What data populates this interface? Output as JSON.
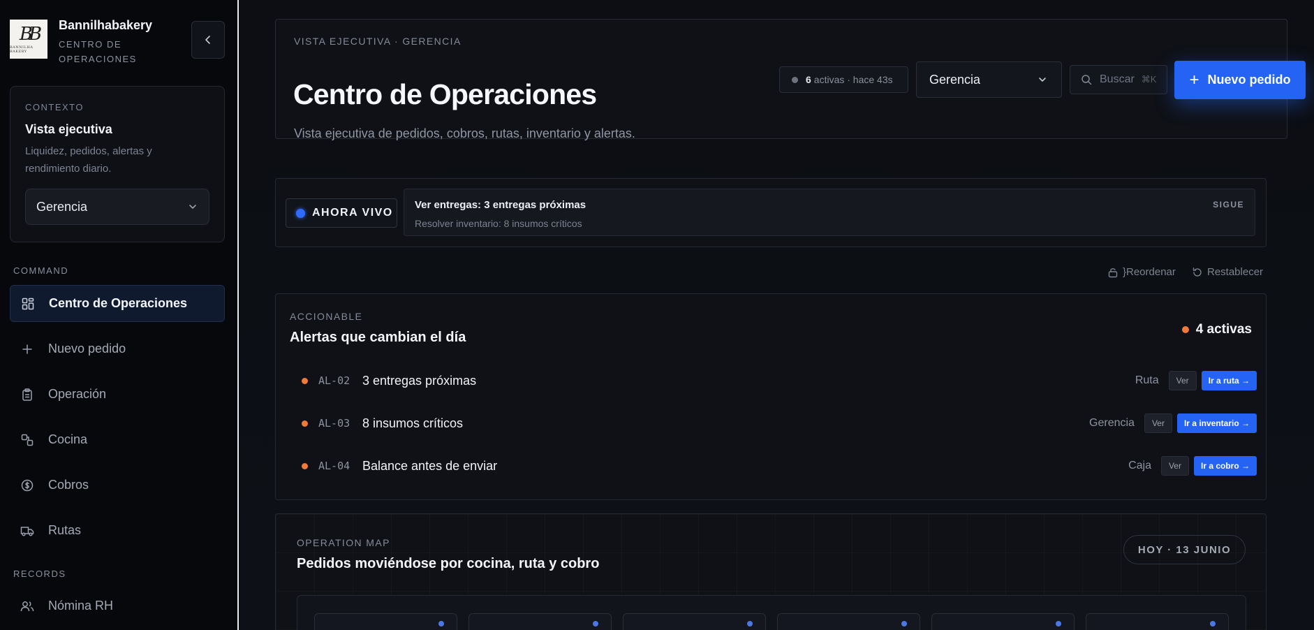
{
  "brand": {
    "name": "Bannilhabakery",
    "subtitle": "CENTRO DE OPERACIONES",
    "logo_mark": "BB",
    "logo_sub": "BANNILHA BAKERY"
  },
  "context": {
    "label": "CONTEXTO",
    "title": "Vista ejecutiva",
    "description": "Liquidez, pedidos, alertas y rendimiento diario.",
    "selected_role": "Gerencia"
  },
  "nav": {
    "command_label": "COMMAND",
    "records_label": "RECORDS",
    "items": [
      {
        "label": "Centro de Operaciones",
        "icon": "dashboard-icon"
      },
      {
        "label": "Nuevo pedido",
        "icon": "plus-icon"
      },
      {
        "label": "Operación",
        "icon": "clipboard-icon"
      },
      {
        "label": "Cocina",
        "icon": "shapes-icon"
      },
      {
        "label": "Cobros",
        "icon": "dollar-icon"
      },
      {
        "label": "Rutas",
        "icon": "truck-icon"
      }
    ],
    "records": [
      {
        "label": "Nómina RH",
        "icon": "users-icon"
      }
    ]
  },
  "header": {
    "eyebrow": "VISTA EJECUTIVA · GERENCIA",
    "title": "Centro de Operaciones",
    "subtitle": "Vista ejecutiva de pedidos, cobros, rutas, inventario y alertas.",
    "status_count": "6",
    "status_text": "activas · hace 43s",
    "role_select": "Gerencia",
    "search_placeholder": "Buscar",
    "search_shortcut": "⌘K",
    "primary_button": "Nuevo pedido"
  },
  "live": {
    "badge": "AHORA VIVO",
    "main": "Ver entregas: 3 entregas próximas",
    "sub": "Resolver inventario: 8 insumos críticos",
    "next_label": "SIGUE"
  },
  "tools": {
    "reorder": "}Reordenar",
    "reset": "Restablecer"
  },
  "alerts": {
    "eyebrow": "ACCIONABLE",
    "title": "Alertas que cambian el día",
    "count": "4 activas",
    "view_label": "Ver",
    "items": [
      {
        "code": "AL-02",
        "title": "3 entregas próximas",
        "area": "Ruta",
        "action": "Ir a ruta →"
      },
      {
        "code": "AL-03",
        "title": "8 insumos críticos",
        "area": "Gerencia",
        "action": "Ir a inventario →"
      },
      {
        "code": "AL-04",
        "title": "Balance antes de enviar",
        "area": "Caja",
        "action": "Ir a cobro →"
      }
    ]
  },
  "map": {
    "eyebrow": "OPERATION MAP",
    "title": "Pedidos moviéndose por cocina, ruta y cobro",
    "date": "HOY · 13 JUNIO"
  },
  "colors": {
    "accent": "#2563f5",
    "alert": "#f07a3a",
    "live": "#2f6bff"
  }
}
